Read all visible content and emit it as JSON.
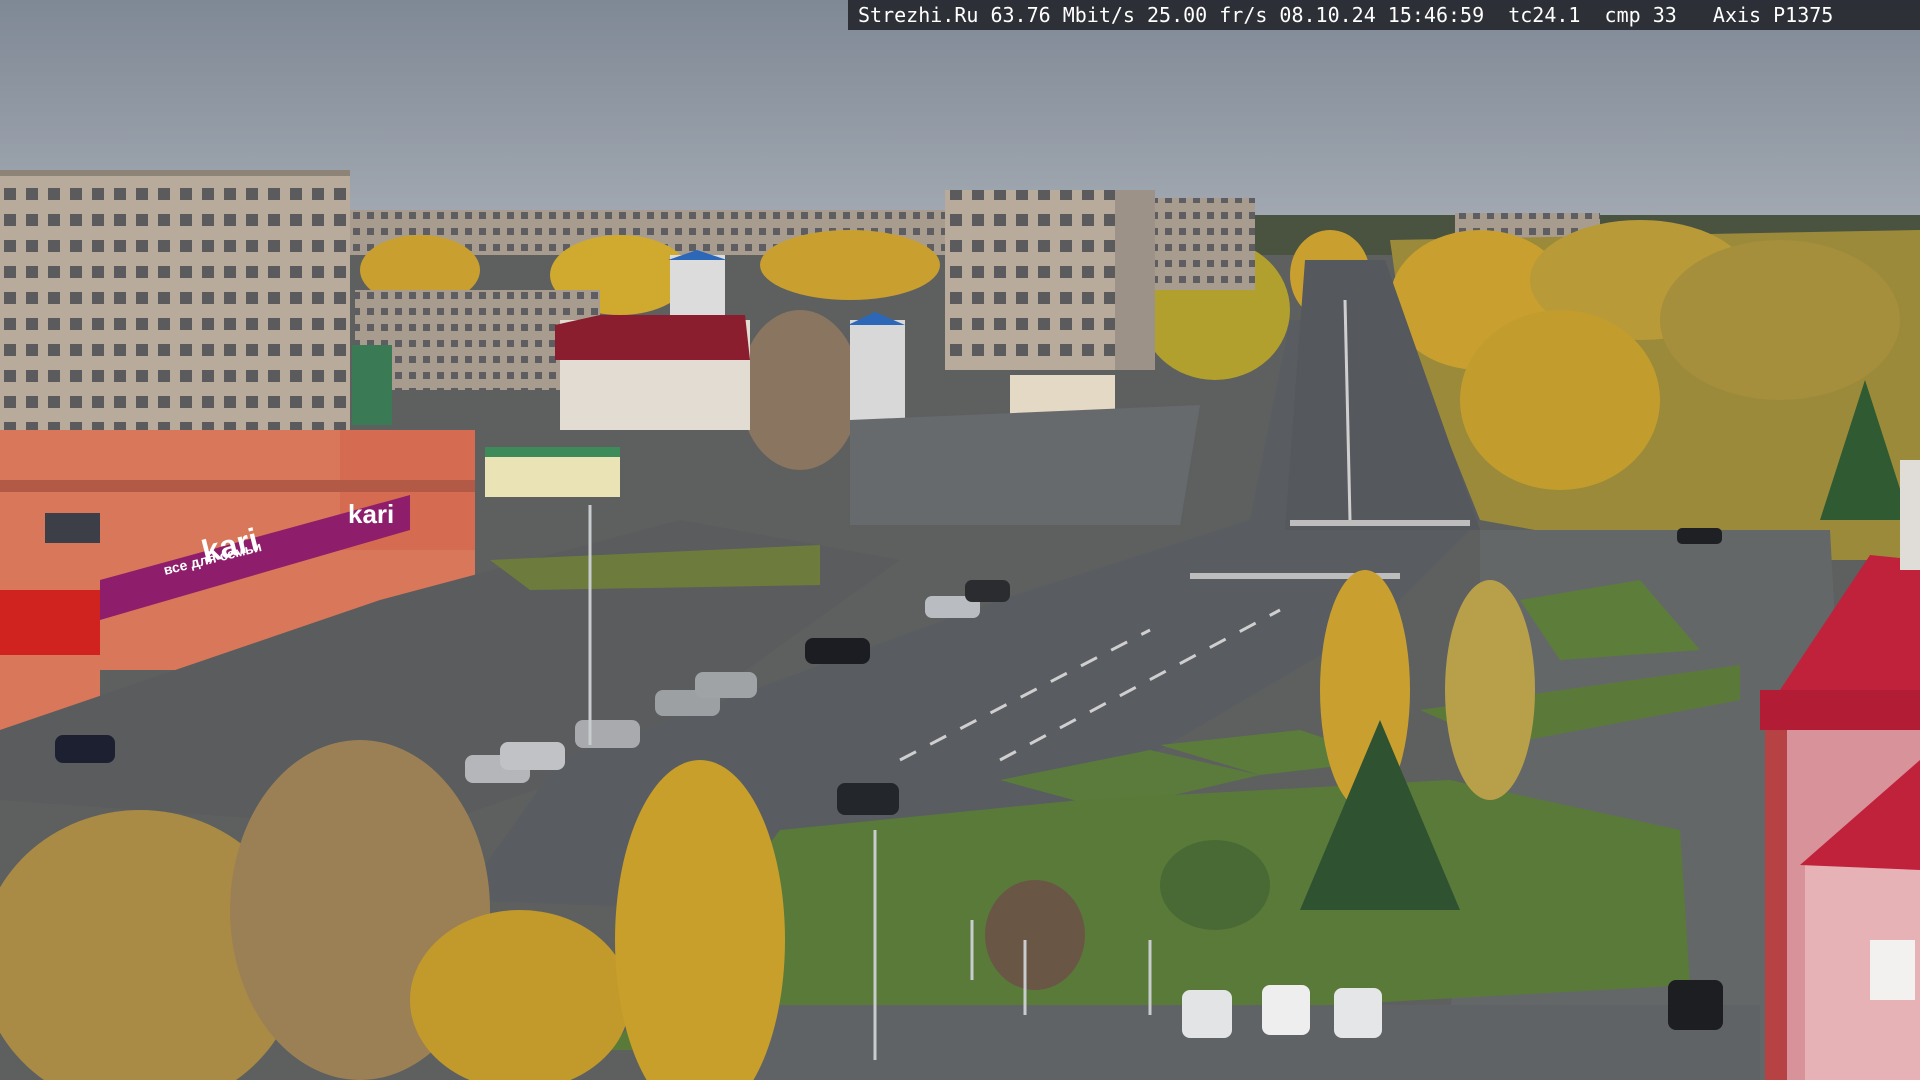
{
  "overlay": {
    "osd_text": "Strezhi.Ru 63.76 Mbit/s 25.00 fr/s 08.10.24 15:46:59  tc24.1  cmp 33   Axis P1375"
  },
  "signs": {
    "store_main": "kari",
    "store_upper": "kari",
    "store_strip": "все для семьи"
  },
  "colors": {
    "sky": "#8e97a3",
    "asphalt": "#5f6266",
    "grass": "#5a7a3a",
    "autumn_foliage": "#c9a030",
    "store_magenta": "#8e1e6b",
    "tower_roof": "#c0213b"
  }
}
